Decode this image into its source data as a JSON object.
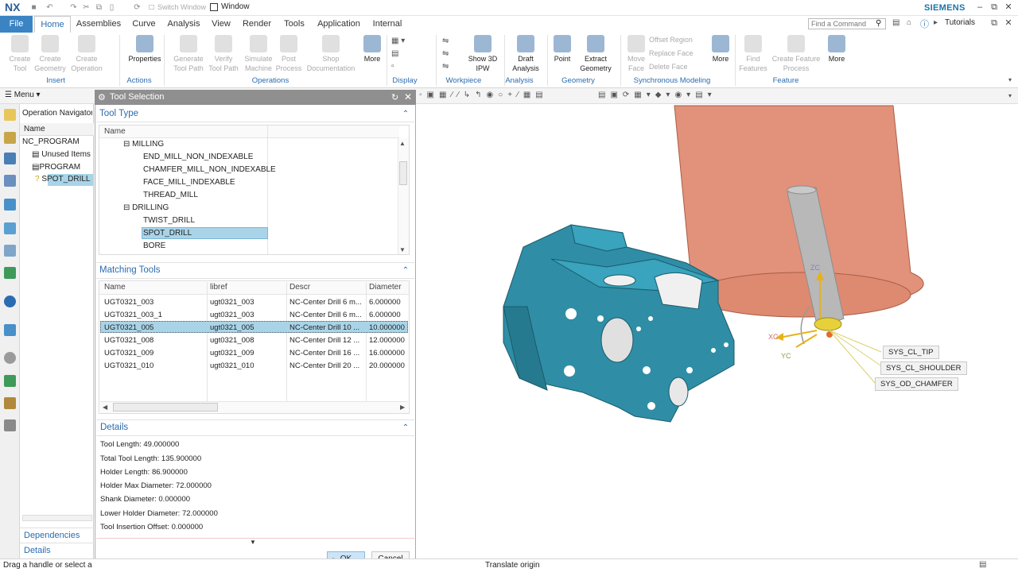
{
  "app": {
    "logo": "NX",
    "brand": "SIEMENS",
    "switch_window": "Switch Window",
    "window_menu": "Window"
  },
  "menu_tabs": [
    "File",
    "Home",
    "Assemblies",
    "Curve",
    "Analysis",
    "View",
    "Render",
    "Tools",
    "Application",
    "Internal"
  ],
  "search": {
    "placeholder": "Find a Command"
  },
  "tutorials": "Tutorials",
  "ribbon": {
    "buttons": [
      {
        "label": "Create\nTool",
        "enabled": false
      },
      {
        "label": "Create\nGeometry",
        "enabled": false
      },
      {
        "label": "Create\nOperation",
        "enabled": false
      },
      {
        "label": "Properties",
        "enabled": true
      },
      {
        "label": "Generate\nTool Path",
        "enabled": false
      },
      {
        "label": "Verify\nTool Path",
        "enabled": false
      },
      {
        "label": "Simulate\nMachine",
        "enabled": false
      },
      {
        "label": "Post\nProcess",
        "enabled": false
      },
      {
        "label": "Shop\nDocumentation",
        "enabled": false
      },
      {
        "label": "More",
        "enabled": true
      },
      {
        "label": "Show 3D\nIPW",
        "enabled": true
      },
      {
        "label": "Draft\nAnalysis",
        "enabled": true
      },
      {
        "label": "Point",
        "enabled": true
      },
      {
        "label": "Extract\nGeometry",
        "enabled": true
      },
      {
        "label": "Move\nFace",
        "enabled": false
      },
      {
        "label": "More",
        "enabled": true
      },
      {
        "label": "Find\nFeatures",
        "enabled": false
      },
      {
        "label": "Create Feature\nProcess",
        "enabled": false
      },
      {
        "label": "More",
        "enabled": true
      }
    ],
    "small_items": [
      "Offset Region",
      "Replace Face",
      "Delete Face"
    ],
    "groups": [
      "Insert",
      "Actions",
      "Operations",
      "Display",
      "Workpiece",
      "Analysis",
      "Geometry",
      "Synchronous Modeling",
      "Feature"
    ]
  },
  "toolbar": {
    "menu_label": "Menu"
  },
  "navigator": {
    "title": "Operation Navigator",
    "column": "Name",
    "items": [
      "NC_PROGRAM",
      "Unused Items",
      "PROGRAM",
      "SPOT_DRILL"
    ],
    "bottom": [
      "Dependencies",
      "Details"
    ]
  },
  "dialog": {
    "title": "Tool Selection",
    "tool_type": {
      "heading": "Tool Type",
      "column": "Name",
      "items": [
        {
          "label": "MILLING",
          "level": 0
        },
        {
          "label": "END_MILL_NON_INDEXABLE",
          "level": 1
        },
        {
          "label": "CHAMFER_MILL_NON_INDEXABLE",
          "level": 1
        },
        {
          "label": "FACE_MILL_INDEXABLE",
          "level": 1
        },
        {
          "label": "THREAD_MILL",
          "level": 1
        },
        {
          "label": "DRILLING",
          "level": 0
        },
        {
          "label": "TWIST_DRILL",
          "level": 1
        },
        {
          "label": "SPOT_DRILL",
          "level": 1,
          "selected": true
        },
        {
          "label": "BORE",
          "level": 1
        }
      ]
    },
    "matching": {
      "heading": "Matching Tools",
      "columns": [
        "Name",
        "libref",
        "Descr",
        "Diameter"
      ],
      "rows": [
        [
          "UGT0321_003",
          "ugt0321_003",
          "NC-Center Drill 6 m...",
          "6.000000"
        ],
        [
          "UGT0321_003_1",
          "ugt0321_003",
          "NC-Center Drill 6 m...",
          "6.000000"
        ],
        [
          "UGT0321_005",
          "ugt0321_005",
          "NC-Center Drill 10 ...",
          "10.000000"
        ],
        [
          "UGT0321_008",
          "ugt0321_008",
          "NC-Center Drill 12 ...",
          "12.000000"
        ],
        [
          "UGT0321_009",
          "ugt0321_009",
          "NC-Center Drill 16 ...",
          "16.000000"
        ],
        [
          "UGT0321_010",
          "ugt0321_010",
          "NC-Center Drill 20 ...",
          "20.000000"
        ]
      ],
      "selected_row": 2
    },
    "details": {
      "heading": "Details",
      "lines": [
        "Tool Length: 49.000000",
        "Total Tool Length: 135.900000",
        "Holder Length: 86.900000",
        "Holder Max Diameter: 72.000000",
        "Shank Diameter: 0.000000",
        "Lower Holder Diameter: 72.000000",
        "Tool Insertion Offset: 0.000000"
      ]
    },
    "ok": "OK",
    "cancel": "Cancel"
  },
  "viewport": {
    "labels": [
      "SYS_CL_TIP",
      "SYS_CL_SHOULDER",
      "SYS_OD_CHAMFER"
    ],
    "axes": {
      "z": "ZC",
      "x": "XC",
      "y": "YC"
    },
    "part_color": "#2f8ea6",
    "holder_color": "#e08a6c"
  },
  "status": {
    "left": "Drag a handle or select a",
    "middle": "Translate origin"
  }
}
